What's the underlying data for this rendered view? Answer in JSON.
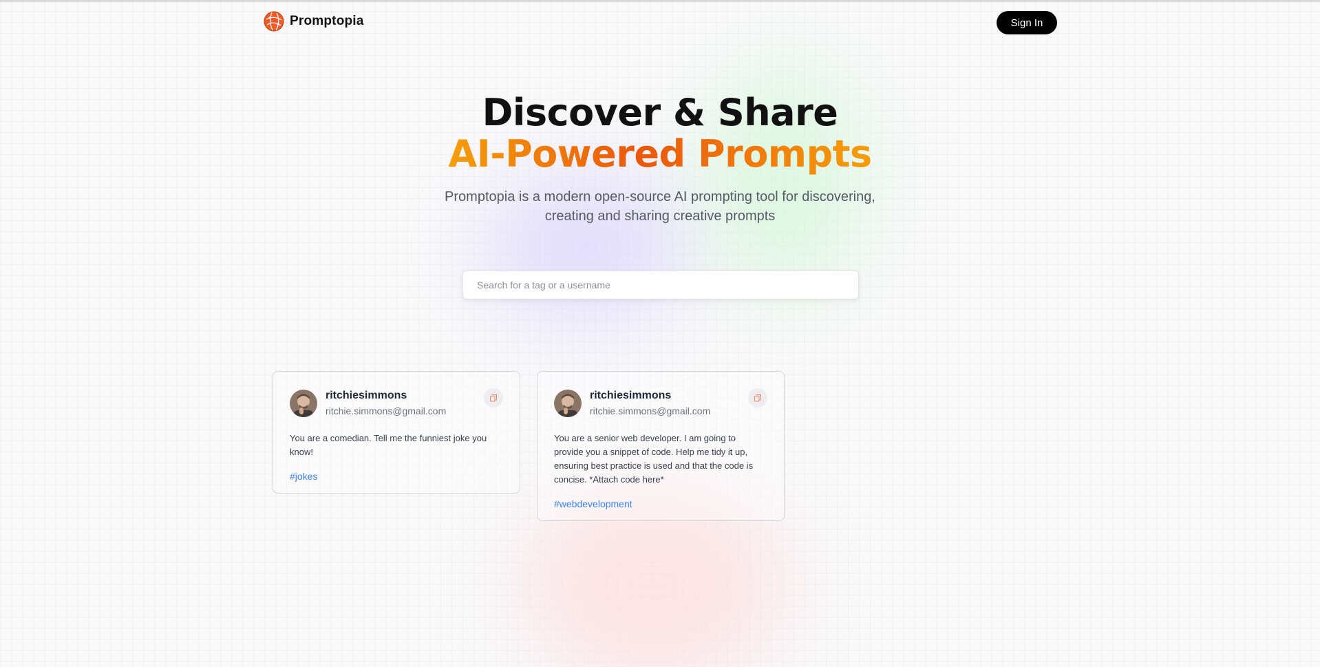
{
  "nav": {
    "logo_text": "Promptopia",
    "sign_in_label": "Sign In"
  },
  "hero": {
    "title_line1": "Discover & Share",
    "title_line2": "AI-Powered Prompts",
    "subtitle_line1": "Promptopia is a modern open-source AI prompting tool for discovering,",
    "subtitle_line2": "creating and sharing creative prompts"
  },
  "search": {
    "placeholder": "Search for a tag or a username",
    "value": ""
  },
  "prompts": [
    {
      "username": "ritchiesimmons",
      "email": "ritchie.simmons@gmail.com",
      "text": "You are a comedian. Tell me the funniest joke you know!",
      "tag": "#jokes"
    },
    {
      "username": "ritchiesimmons",
      "email": "ritchie.simmons@gmail.com",
      "text": "You are a senior web developer. I am going to provide you a snippet of code. Help me tidy it up, ensuring best practice is used and that the code is concise. *Attach code here*",
      "tag": "#webdevelopment"
    }
  ],
  "colors": {
    "accent_orange": "#ea580c",
    "accent_amber": "#f59e0b",
    "tag_blue": "#3b82f6",
    "button_black": "#000000"
  },
  "icons": {
    "logo": "globe-logo-icon",
    "copy": "copy-icon",
    "avatar": "user-avatar"
  }
}
